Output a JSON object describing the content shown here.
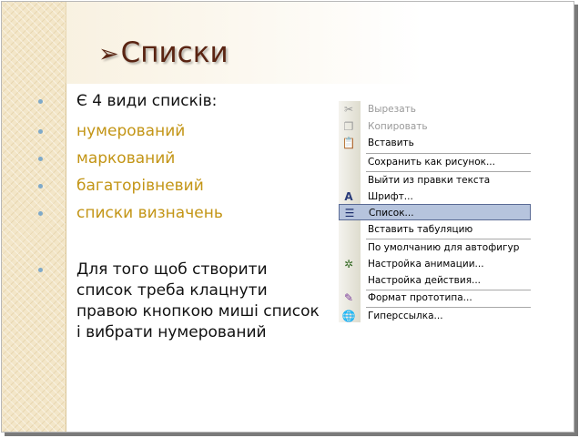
{
  "slide": {
    "title": "Списки",
    "bullets": [
      "Є 4 види списків:",
      "нумерований",
      "маркований",
      "багаторівневий",
      "списки визначень"
    ],
    "paragraph_lines": [
      "Для того щоб створити",
      "список треба клацнути",
      "правою кнопкою миші список",
      "і вибрати нумерований"
    ]
  },
  "colors": {
    "title": "#5a2412",
    "sub_bullet": "#c39516",
    "bullet_marker": "#7ea9c9",
    "menu_highlight": "#b6c4dd"
  },
  "context_menu": {
    "items": [
      {
        "label": "Вырезать",
        "icon": "scissors-icon",
        "disabled": true
      },
      {
        "label": "Копировать",
        "icon": "copy-icon",
        "disabled": true
      },
      {
        "label": "Вставить",
        "icon": "paste-icon"
      },
      {
        "label": "Сохранить как рисунок...",
        "icon": ""
      },
      {
        "label": "Выйти из правки текста",
        "icon": ""
      },
      {
        "label": "Шрифт...",
        "icon": "font-icon"
      },
      {
        "label": "Список...",
        "icon": "list-icon",
        "highlighted": true
      },
      {
        "label": "Вставить табуляцию",
        "icon": ""
      },
      {
        "label": "По умолчанию для автофигур",
        "icon": ""
      },
      {
        "label": "Настройка анимации...",
        "icon": "animation-icon"
      },
      {
        "label": "Настройка действия...",
        "icon": ""
      },
      {
        "label": "Формат прототипа...",
        "icon": "format-icon"
      },
      {
        "label": "Гиперссылка...",
        "icon": "hyperlink-icon"
      }
    ]
  }
}
